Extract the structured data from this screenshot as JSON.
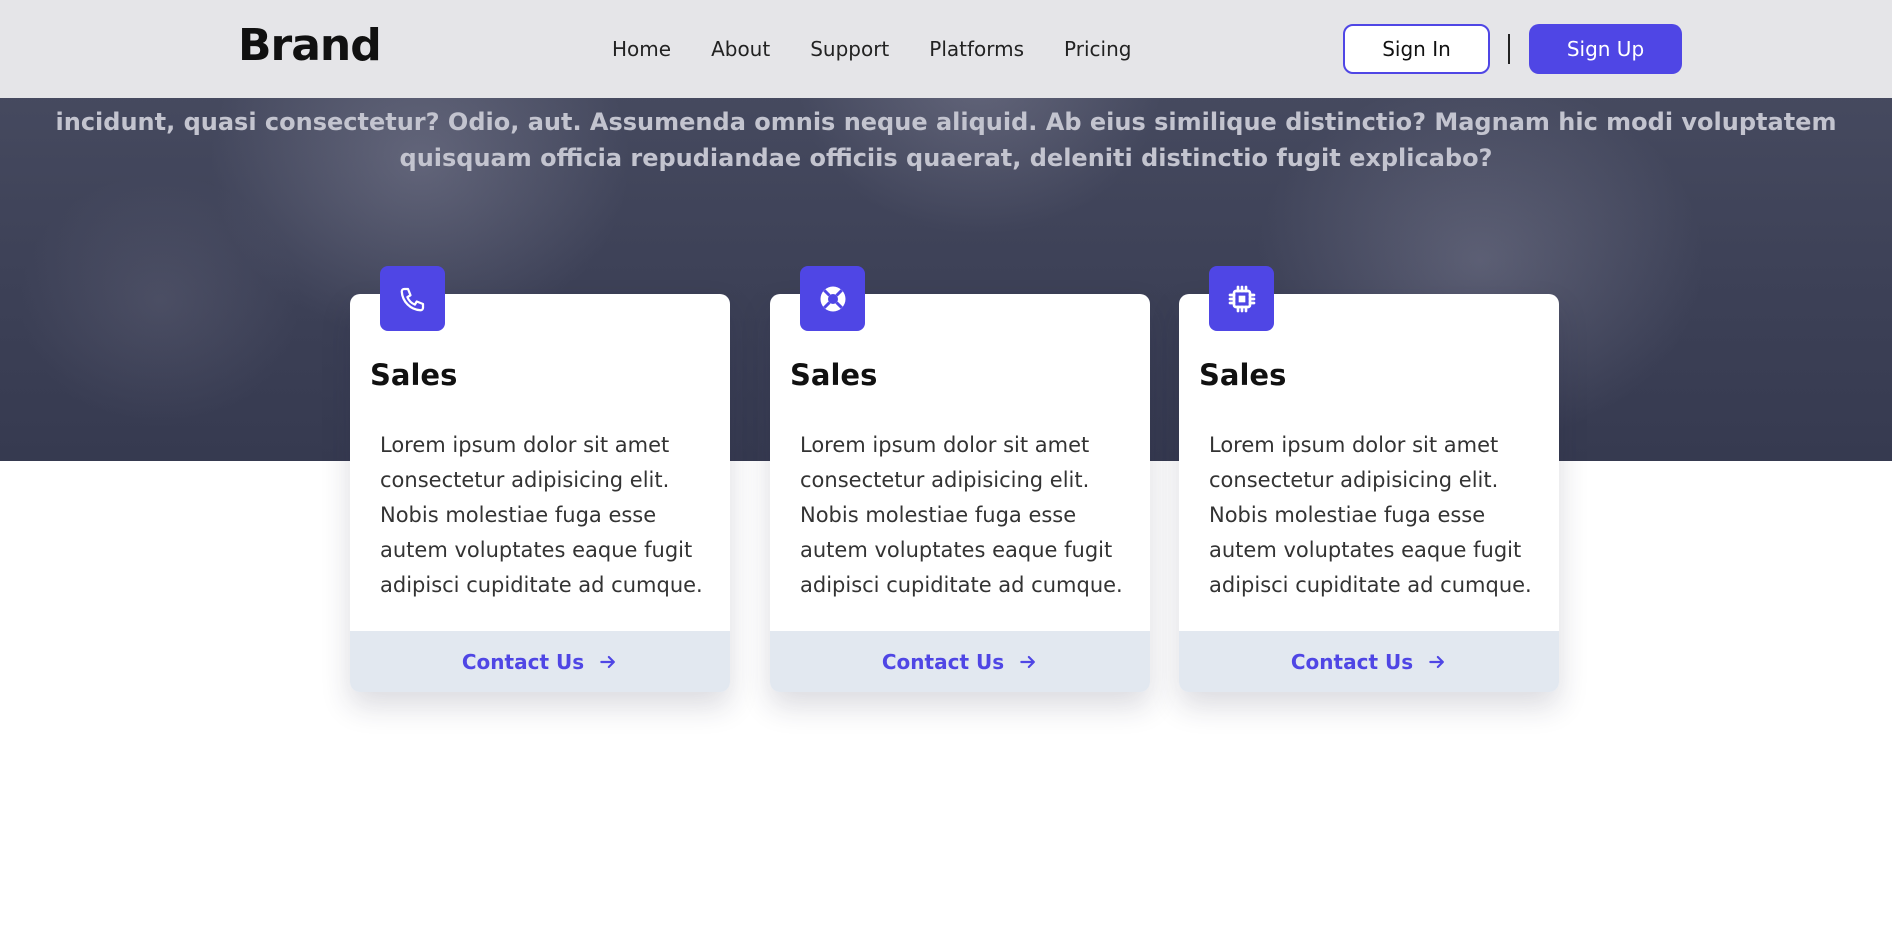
{
  "nav": {
    "brand": "Brand",
    "links": [
      "Home",
      "About",
      "Support",
      "Platforms",
      "Pricing"
    ],
    "sign_in": "Sign In",
    "sign_up": "Sign Up"
  },
  "hero": {
    "text": "incidunt, quasi consectetur? Odio, aut. Assumenda omnis neque aliquid. Ab eius similique distinctio? Magnam hic modi voluptatem quisquam officia repudiandae officiis quaerat, deleniti distinctio fugit explicabo?"
  },
  "cards": [
    {
      "icon": "phone-icon",
      "title": "Sales",
      "text": "Lorem ipsum dolor sit amet consectetur adipisicing elit. Nobis molestiae fuga esse autem voluptates eaque fugit adipisci cupiditate ad cumque.",
      "cta": "Contact Us"
    },
    {
      "icon": "lifebuoy-icon",
      "title": "Sales",
      "text": "Lorem ipsum dolor sit amet consectetur adipisicing elit. Nobis molestiae fuga esse autem voluptates eaque fugit adipisci cupiditate ad cumque.",
      "cta": "Contact Us"
    },
    {
      "icon": "chip-icon",
      "title": "Sales",
      "text": "Lorem ipsum dolor sit amet consectetur adipisicing elit. Nobis molestiae fuga esse autem voluptates eaque fugit adipisci cupiditate ad cumque.",
      "cta": "Contact Us"
    }
  ],
  "colors": {
    "accent": "#4f46e5",
    "navbar_bg": "#e5e5e8",
    "card_footer_bg": "#e2e8f0"
  }
}
